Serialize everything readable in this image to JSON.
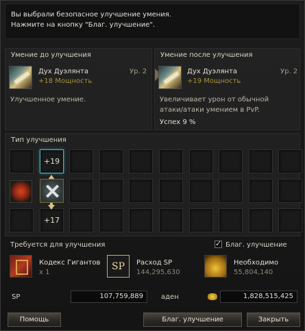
{
  "message": {
    "line1": "Вы выбрали безопасное улучшение умения.",
    "line2": "Нажмите на кнопку \"Благ. улучшение\"."
  },
  "before": {
    "title": "Умение до улучшения",
    "skill_name": "Дух Дуэлянта",
    "level": "Ур. 2",
    "power": "+18 Мощность",
    "description": "Улучшенное умение."
  },
  "after": {
    "title": "Умение после улучшения",
    "skill_name": "Дух Дуэлянта",
    "level": "Ур. 2",
    "power": "+19 Мощность",
    "description_line1": "Увеличивает урон от обычной",
    "description_line2": "атаки/атаки умением в PvP.",
    "success": "Успех 9 %"
  },
  "enchant_types": {
    "title": "Тип улучшения",
    "upper_value": "+19",
    "lower_value": "+17"
  },
  "requirements": {
    "title": "Требуется для улучшения",
    "blessed_label": "Благ. улучшение",
    "blessed_checked": true,
    "items": [
      {
        "name": "Кодекс Гигантов",
        "sub": "x 1",
        "icon": "book-icon"
      },
      {
        "name": "Расход SP",
        "sub": "144,295,630",
        "icon": "sp-icon",
        "icon_text": "SP"
      },
      {
        "name": "Необходимо",
        "sub": "55,804,140",
        "icon": "adena-icon"
      }
    ]
  },
  "balances": {
    "sp_label": "SP",
    "sp_value": "107,759,889",
    "adena_label": "аден",
    "adena_value": "1,828,515,425"
  },
  "buttons": {
    "help": "Помощь",
    "blessed_enchant": "Благ. улучшение",
    "close": "Закрыть"
  }
}
